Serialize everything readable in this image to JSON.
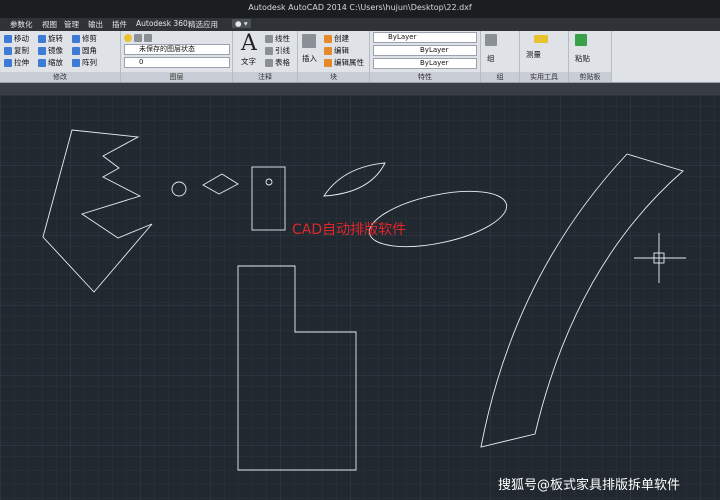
{
  "window": {
    "title": "Autodesk AutoCAD 2014     C:\\Users\\hujun\\Desktop\\22.dxf"
  },
  "menu": {
    "tabs": [
      "参数化",
      "视图",
      "管理",
      "输出",
      "插件",
      "Autodesk 360",
      "精选应用"
    ]
  },
  "ribbon": {
    "modify": {
      "title": "修改",
      "move": "移动",
      "rotate": "旋转",
      "trim": "修剪",
      "copy": "复制",
      "mirror": "镜像",
      "fillet": "圆角",
      "stretch": "拉伸",
      "scale": "缩放",
      "array": "阵列"
    },
    "layers": {
      "title": "图层",
      "state": "未保存的图层状态",
      "current": "0"
    },
    "annotation": {
      "title": "注释",
      "text": "文字",
      "linear": "线性",
      "leader": "引线",
      "table": "表格"
    },
    "block": {
      "title": "块",
      "insert": "插入",
      "create": "创建",
      "edit": "编辑",
      "edit_attr": "编辑属性"
    },
    "properties": {
      "title": "特性",
      "color": "ByLayer",
      "linetype": "ByLayer",
      "lineweight": "ByLayer"
    },
    "groups": {
      "title": "组",
      "group": "组"
    },
    "utilities": {
      "title": "实用工具",
      "measure": "测量"
    },
    "clipboard": {
      "title": "剪贴板",
      "paste": "粘贴"
    }
  },
  "canvas": {
    "annotation": "CAD自动排版软件",
    "watermark": "搜狐号@板式家具排版拆单软件"
  },
  "colors": {
    "canvas_bg": "#212830",
    "annotation": "#e0272c",
    "geometry": "#e8eef4"
  }
}
